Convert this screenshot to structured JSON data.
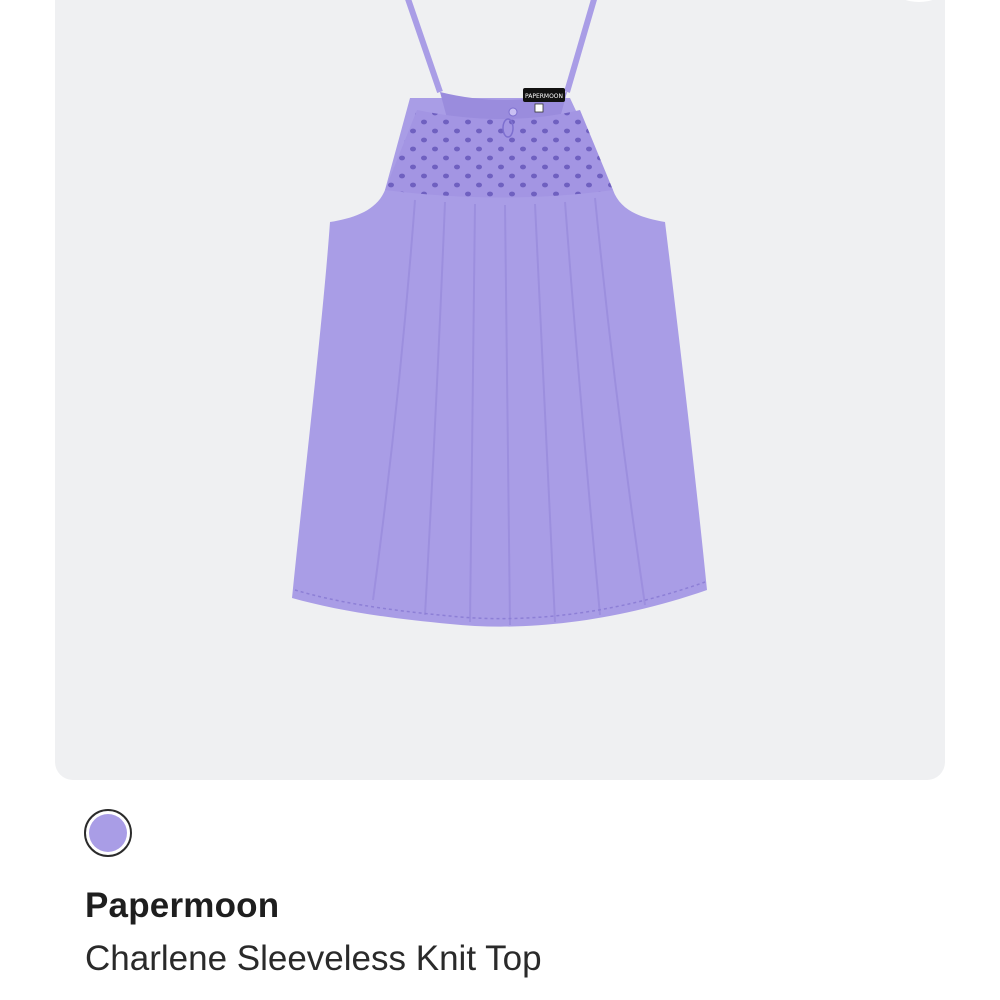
{
  "product": {
    "brand": "Papermoon",
    "name": "Charlene Sleeveless Knit Top",
    "image_alt": "Lavender sleeveless knit halter top with eyelet yoke",
    "label_text": "PAPERMOON"
  },
  "swatches": [
    {
      "color_hex": "#a99de6",
      "selected": true
    }
  ],
  "colors": {
    "card_background": "#eff0f2",
    "garment": "#a99de6",
    "garment_shade": "#9a8cdd"
  },
  "icons": {
    "favorite": "heart-icon"
  }
}
